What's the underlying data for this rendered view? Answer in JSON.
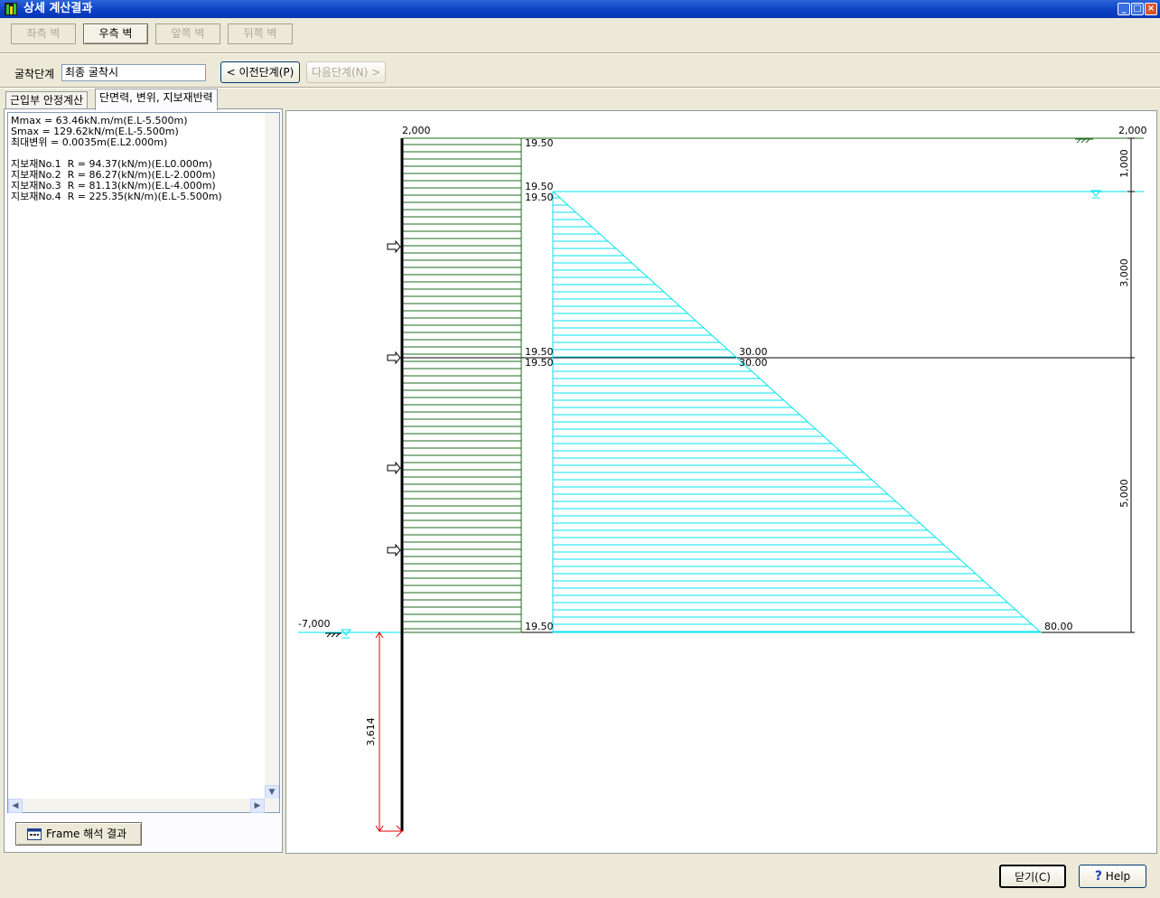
{
  "window": {
    "title": "상세 계산결과",
    "min": "_",
    "max": "□",
    "close": "×"
  },
  "walls": [
    "좌측 벽",
    "우측 벽",
    "앞쪽 벽",
    "뒤쪽 벽"
  ],
  "stage": {
    "label": "굴착단계",
    "value": "최종 굴착시",
    "prev_button": "< 이전단계(P)",
    "next_button": "다음단계(N) >"
  },
  "tabs": [
    "근입부 안정계산",
    "단면력, 변위, 지보재반력"
  ],
  "results": [
    "Mmax = 63.46kN.m/m(E.L-5.500m)",
    "Smax = 129.62kN/m(E.L-5.500m)",
    "최대변위 = 0.0035m(E.L2.000m)",
    "",
    "지보재No.1  R = 94.37(kN/m)(E.L0.000m)",
    "지보재No.2  R = 86.27(kN/m)(E.L-2.000m)",
    "지보재No.3  R = 81.13(kN/m)(E.L-4.000m)",
    "지보재No.4  R = 225.35(kN/m)(E.L-5.500m)"
  ],
  "frame_button": "Frame 해석 결과",
  "diagram": {
    "top_level_left": "2,000",
    "top_level_right": "2,000",
    "excavation_level": "-7,000",
    "embed_depth": "3,614",
    "rect_labels": [
      "19.50",
      "19.50",
      "19.50",
      "19.50",
      "19.50",
      "19.50"
    ],
    "tri_labels": [
      "30.00",
      "30.00",
      "80.00"
    ],
    "dims": [
      "1,000",
      "3,000",
      "5,000"
    ]
  },
  "buttons": {
    "close": "닫기(C)",
    "help": "Help"
  },
  "colors": {
    "green": "#1f6b1f",
    "cyan": "#00e5f0",
    "red": "#e00000"
  }
}
